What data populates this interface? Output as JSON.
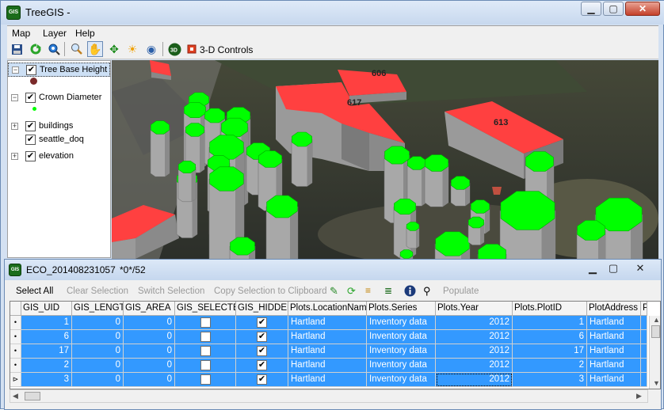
{
  "app": {
    "title": "TreeGIS -"
  },
  "menu": [
    "Map",
    "Layer",
    "Help"
  ],
  "toolbar": {
    "controls_label": "3-D Controls"
  },
  "legend": {
    "layers": [
      {
        "label": "Tree Base Height",
        "checked": true,
        "expanded": true
      },
      {
        "label": "Crown Diameter",
        "checked": true,
        "expanded": true
      },
      {
        "label": "buildings",
        "checked": true,
        "expanded": false
      },
      {
        "label": "seattle_doq",
        "checked": true,
        "expanded": false
      },
      {
        "label": "elevation",
        "checked": true,
        "expanded": false
      }
    ],
    "colors": {
      "tree_base": "#7a2a2a",
      "crown": "#00ff00"
    }
  },
  "map": {
    "building_labels": [
      "606",
      "617",
      "613"
    ],
    "tree_color": "#00ff00",
    "roof_color": "#ff4040"
  },
  "table": {
    "title": "ECO_201408231057",
    "status": "*0*/52",
    "toolbar": {
      "select_all": "Select All",
      "clear_selection": "Clear Selection",
      "switch_selection": "Switch Selection",
      "copy_selection": "Copy Selection to Clipboard",
      "populate": "Populate"
    },
    "columns": [
      "GIS_UID",
      "GIS_LENGTH",
      "GIS_AREA",
      "GIS_SELECTED",
      "GIS_HIDDEN",
      "Plots.LocationName",
      "Plots.Series",
      "Plots.Year",
      "Plots.PlotID",
      "PlotAddress",
      "P"
    ],
    "rows": [
      {
        "uid": "1",
        "length": "0",
        "area": "0",
        "selected": "",
        "hidden": "✔",
        "location": "Hartland",
        "series": "Inventory data",
        "year": "2012",
        "plotid": "1",
        "address": "Hartland"
      },
      {
        "uid": "6",
        "length": "0",
        "area": "0",
        "selected": "",
        "hidden": "✔",
        "location": "Hartland",
        "series": "Inventory data",
        "year": "2012",
        "plotid": "6",
        "address": "Hartland"
      },
      {
        "uid": "17",
        "length": "0",
        "area": "0",
        "selected": "",
        "hidden": "✔",
        "location": "Hartland",
        "series": "Inventory data",
        "year": "2012",
        "plotid": "17",
        "address": "Hartland"
      },
      {
        "uid": "2",
        "length": "0",
        "area": "0",
        "selected": "",
        "hidden": "✔",
        "location": "Hartland",
        "series": "Inventory data",
        "year": "2012",
        "plotid": "2",
        "address": "Hartland"
      },
      {
        "uid": "3",
        "length": "0",
        "area": "0",
        "selected": "",
        "hidden": "✔",
        "location": "Hartland",
        "series": "Inventory data",
        "year": "2012",
        "plotid": "3",
        "address": "Hartland"
      }
    ],
    "row_markers": [
      "•",
      "•",
      "•",
      "•",
      "⊳"
    ],
    "selection_color": "#3399ff"
  }
}
